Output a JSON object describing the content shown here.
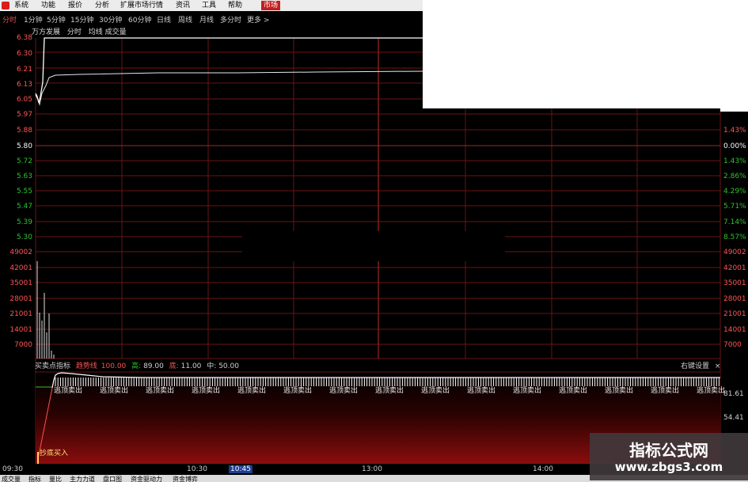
{
  "menu": {
    "items": [
      "系统",
      "功能",
      "报价",
      "分析",
      "扩展市场行情",
      "资讯",
      "工具",
      "帮助",
      "市场"
    ],
    "active_index": 8
  },
  "periods": [
    "分时",
    "1分钟",
    "5分钟",
    "15分钟",
    "30分钟",
    "60分钟",
    "日线",
    "周线",
    "月线",
    "多分时",
    "更多 >"
  ],
  "chart_title": {
    "name": "万方发展",
    "mode": "分时",
    "avg": "均线",
    "vol": "成交量"
  },
  "price_axis": {
    "top_labels": [
      "6.38",
      "6.30",
      "6.21",
      "6.13",
      "6.05"
    ],
    "main_labels": [
      "5.97",
      "5.88",
      "5.80",
      "5.72",
      "5.63",
      "5.55",
      "5.47",
      "5.39",
      "5.30"
    ],
    "percent_labels": [
      "1.43%",
      "0.00%",
      "1.43%",
      "2.86%",
      "4.29%",
      "5.71%",
      "7.14%",
      "8.57%"
    ],
    "volume_labels": [
      "49002",
      "42001",
      "35001",
      "28001",
      "21001",
      "14001",
      "7000"
    ]
  },
  "indicator": {
    "name": "买卖点指标",
    "line_label": "趋势线",
    "line_value": "100.00",
    "high_label": "高:",
    "high_value": "89.00",
    "low_label": "底:",
    "low_value": "11.00",
    "mid_label": "中:",
    "mid_value": "50.00",
    "settings": "右键设置",
    "close": "×",
    "signal_text": "逃顶卖出",
    "buy_text": "抄底买入",
    "right_labels": [
      "81.61",
      "54.41"
    ]
  },
  "time_axis": [
    "09:30",
    "10:30",
    "10:45",
    "13:00",
    "14:00"
  ],
  "bottom_tabs": [
    "成交量",
    "指标",
    "量比",
    "主力力道",
    "盘口图",
    "资金驱动力",
    "资金博弈"
  ],
  "watermark": {
    "title": "指标公式网",
    "url": "www.zbgs3.com"
  },
  "colors": {
    "grid_red": "#6a1414",
    "up_red": "#ff4040",
    "down_green": "#30c030",
    "price_line": "#ffffff"
  }
}
